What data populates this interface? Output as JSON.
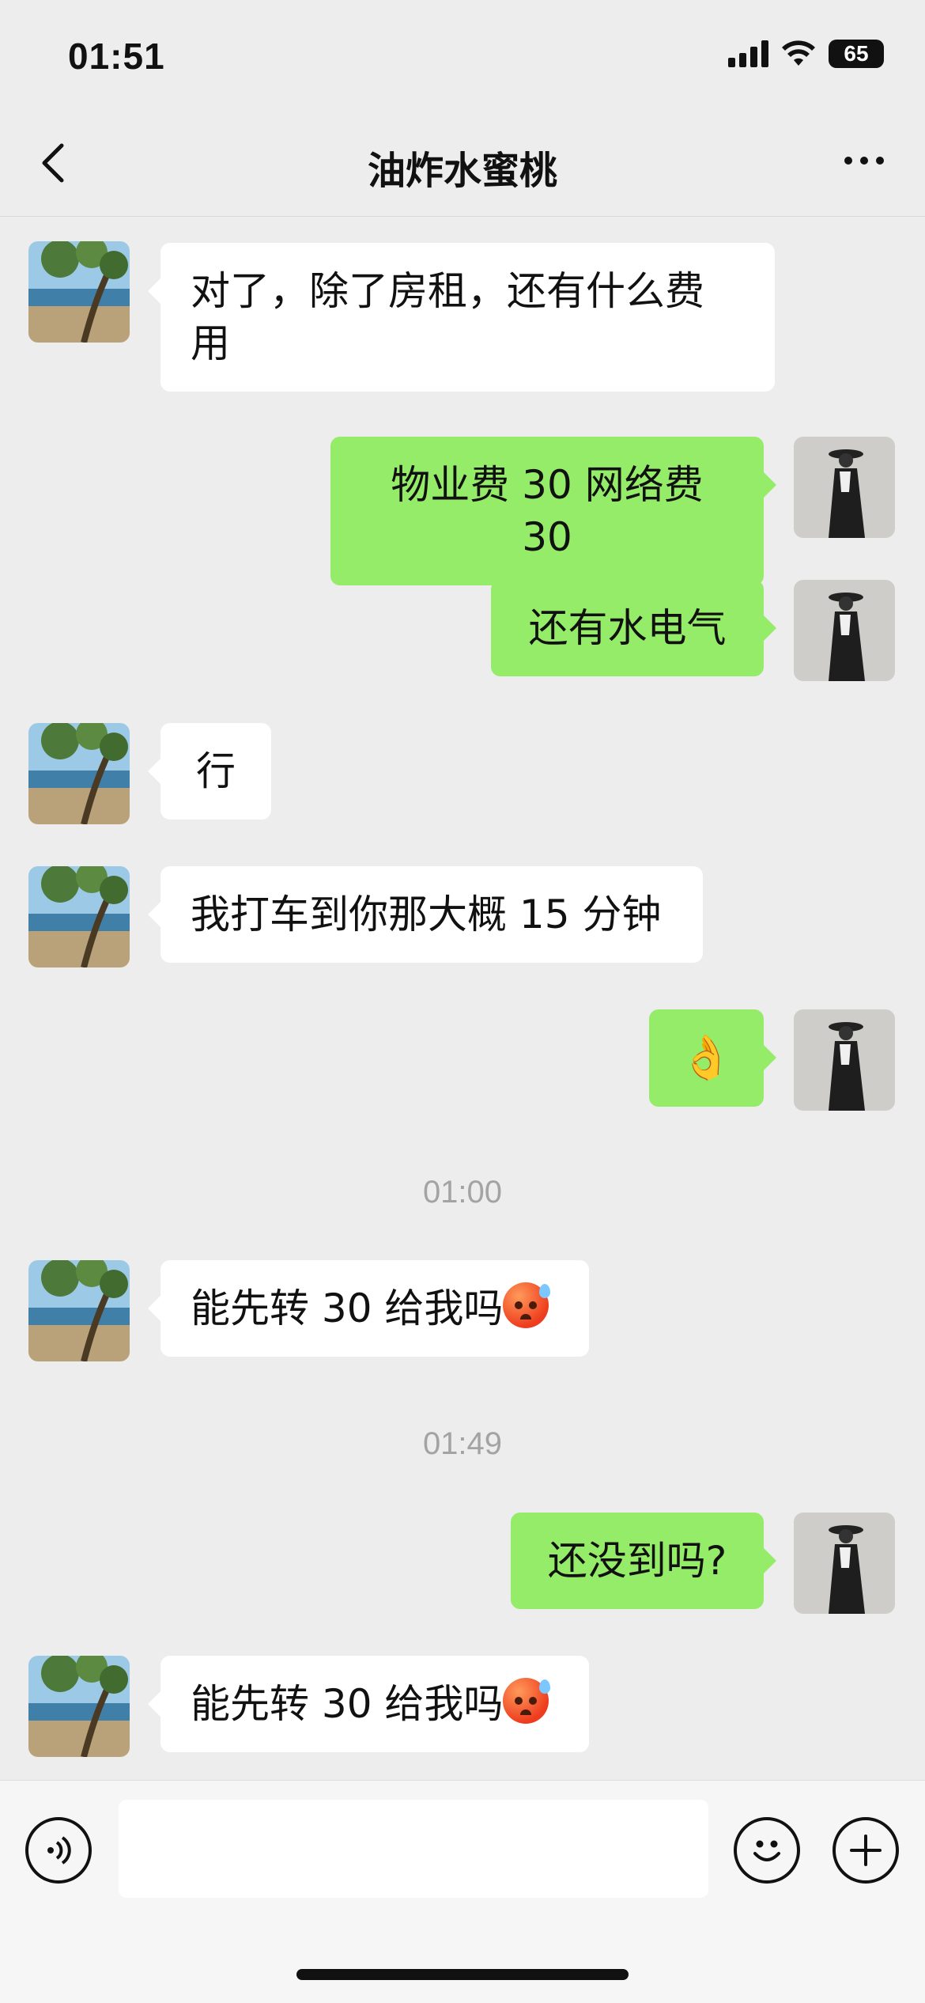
{
  "status_bar": {
    "time": "01:51",
    "battery": "65"
  },
  "header": {
    "title": "油炸水蜜桃"
  },
  "messages": [
    {
      "side": "left",
      "text_line1": "对了，除了房租，还有什么费",
      "text_line2": "用"
    },
    {
      "side": "right",
      "text": "物业费 30 网络费 30"
    },
    {
      "side": "right",
      "text": "还有水电气"
    },
    {
      "side": "left",
      "text": "行"
    },
    {
      "side": "left",
      "text": "我打车到你那大概 15 分钟"
    },
    {
      "side": "right",
      "text": "👌"
    },
    {
      "type": "time",
      "text": "01:00"
    },
    {
      "side": "left",
      "text": "能先转 30 给我吗",
      "emoji": "anxious-sweat-face"
    },
    {
      "type": "time",
      "text": "01:49"
    },
    {
      "side": "right",
      "text": "还没到吗?"
    },
    {
      "side": "left",
      "text": "能先转 30 给我吗",
      "emoji": "anxious-sweat-face"
    }
  ],
  "input": {
    "value": ""
  },
  "colors": {
    "outgoing_bubble": "#95ec69",
    "incoming_bubble": "#ffffff",
    "background": "#ededed"
  }
}
